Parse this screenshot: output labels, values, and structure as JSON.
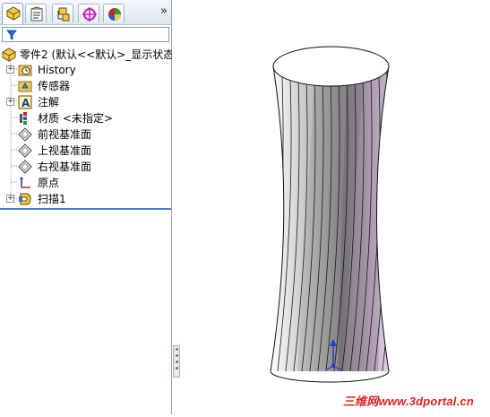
{
  "feature_manager": {
    "tabs": [
      {
        "name": "featuremanager-tab",
        "icon": "feature-tree-icon",
        "active": true
      },
      {
        "name": "propertymanager-tab",
        "icon": "property-manager-icon",
        "active": false
      },
      {
        "name": "configurationmanager-tab",
        "icon": "configuration-manager-icon",
        "active": false
      },
      {
        "name": "dimxpert-tab",
        "icon": "dimxpert-crosshair-icon",
        "active": false
      },
      {
        "name": "display-manager-tab",
        "icon": "display-manager-icon",
        "active": false
      }
    ],
    "more_label": "»",
    "filter_icon": "filter-funnel-icon",
    "part_title": "零件2 (默认<<默认>_显示状态",
    "items": [
      {
        "label": "History",
        "icon": "history-folder-icon",
        "expandable": true
      },
      {
        "label": "传感器",
        "icon": "sensors-folder-icon",
        "expandable": false
      },
      {
        "label": "注解",
        "icon": "annotations-icon",
        "expandable": true
      },
      {
        "label": "材质 <未指定>",
        "icon": "material-icon",
        "expandable": false
      },
      {
        "label": "前视基准面",
        "icon": "plane-icon",
        "expandable": false
      },
      {
        "label": "上视基准面",
        "icon": "plane-icon",
        "expandable": false
      },
      {
        "label": "右视基准面",
        "icon": "plane-icon",
        "expandable": false
      },
      {
        "label": "原点",
        "icon": "origin-icon",
        "expandable": false
      },
      {
        "label": "扫描1",
        "icon": "sweep-feature-icon",
        "expandable": true
      }
    ]
  },
  "viewport": {
    "model": "twisted-sweep-body",
    "triad_icon": "coordinate-triad-icon",
    "watermark": "三维网www.3dportal.cn",
    "colors": {
      "accent": "#1f3fcf",
      "watermark": "#e02020",
      "model_light": "#ffffff",
      "model_dark": "#5a5a5a",
      "model_tint": "#e0c8e6"
    }
  }
}
